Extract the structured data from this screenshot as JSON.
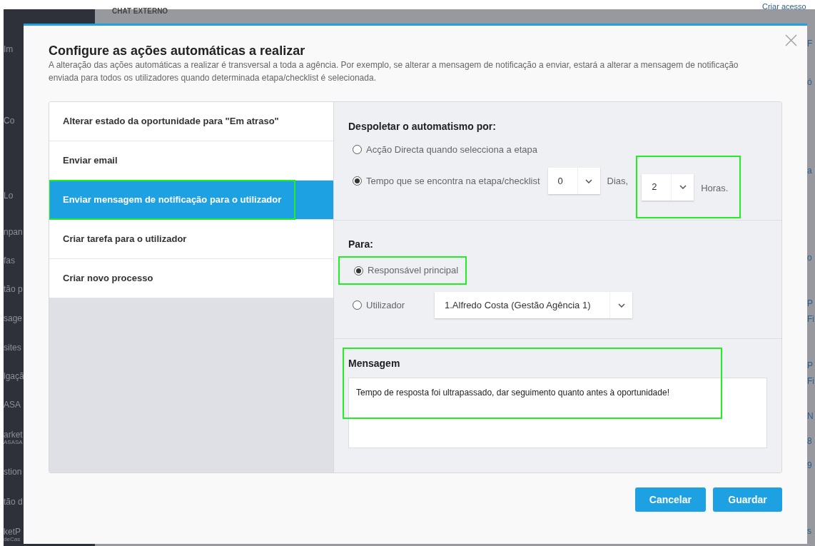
{
  "background": {
    "top_left_text": "CHAT EXTERNO",
    "top_right_text": "Criar acesso",
    "sidebar_fragments": [
      "Im",
      "Co",
      "Lo",
      "npan",
      "fas",
      "tão p",
      "sage",
      "sites",
      "lgaçã",
      "ASA",
      "arket",
      "ASASA",
      "stion",
      "tão d",
      "ketP",
      "deCas"
    ],
    "right_fragments": [
      "F",
      "ó",
      "a",
      "o",
      "P",
      "Fi",
      "P",
      "Fi",
      "N",
      "8",
      "9",
      "s"
    ]
  },
  "dialog": {
    "title": "Configure as ações automáticas a realizar",
    "description": "A alteração das ações automáticas a realizar é transversal a toda a agência. Por exemplo, se alterar a mensagem de notificação a enviar, estará a alterar a mensagem de notificação enviada para todos os utilizadores quando determinada etapa/checklist é selecionada.",
    "actions": [
      {
        "label": "Alterar estado da oportunidade para \"Em atraso\"",
        "selected": false,
        "highlighted": false
      },
      {
        "label": "Enviar email",
        "selected": false,
        "highlighted": false
      },
      {
        "label": "Enviar mensagem de notificação para o utilizador",
        "selected": true,
        "highlighted": true
      },
      {
        "label": "Criar tarefa para o utilizador",
        "selected": false,
        "highlighted": false
      },
      {
        "label": "Criar novo processo",
        "selected": false,
        "highlighted": false
      }
    ],
    "trigger": {
      "heading": "Despoletar o automatismo por:",
      "direct": {
        "label": "Acção Directa quando selecciona a etapa",
        "selected": false
      },
      "time": {
        "label": "Tempo que se encontra na etapa/checklist",
        "selected": true,
        "days_value": "0",
        "days_label": "Dias,",
        "hours_value": "2",
        "hours_label": "Horas.",
        "hours_highlighted": true
      }
    },
    "recipient": {
      "heading": "Para:",
      "main": {
        "label": "Responsável principal",
        "selected": true,
        "highlighted": true
      },
      "user": {
        "label": "Utilizador",
        "selected": false,
        "value": "1.Alfredo Costa (Gestão Agência 1)"
      }
    },
    "message": {
      "heading": "Mensagem",
      "value": "Tempo de resposta foi ultrapassado, dar seguimento quanto antes à oportunidade!",
      "highlighted": true
    },
    "buttons": {
      "cancel": "Cancelar",
      "save": "Guardar"
    }
  }
}
